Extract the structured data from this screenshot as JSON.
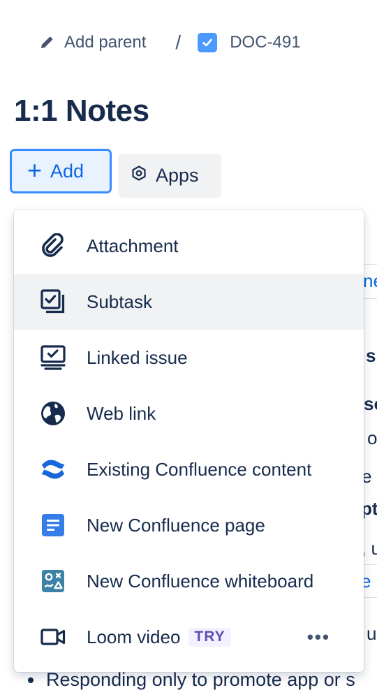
{
  "breadcrumb": {
    "parent_label": "Add parent",
    "separator": "/",
    "issue_key": "DOC-491"
  },
  "title": "1:1 Notes",
  "actions": {
    "add_label": "Add",
    "apps_label": "Apps"
  },
  "background_text": {
    "frag_1": "ne",
    "frag_2": "s",
    "frag_3": "so",
    "frag_4": "o",
    "frag_5": "e",
    "frag_6": "pt",
    "frag_7": ", u",
    "frag_8": "e",
    "frag_9": "ui",
    "bullet": "Responding only to promote app or s"
  },
  "menu": {
    "items": [
      {
        "label": "Attachment",
        "icon": "paperclip-icon"
      },
      {
        "label": "Subtask",
        "icon": "subtask-icon"
      },
      {
        "label": "Linked issue",
        "icon": "linked-issue-icon"
      },
      {
        "label": "Web link",
        "icon": "globe-icon"
      },
      {
        "label": "Existing Confluence content",
        "icon": "confluence-icon"
      },
      {
        "label": "New Confluence page",
        "icon": "confluence-page-icon"
      },
      {
        "label": "New Confluence whiteboard",
        "icon": "confluence-whiteboard-icon"
      },
      {
        "label": "Loom video",
        "icon": "video-camera-icon",
        "badge": "TRY"
      }
    ],
    "selected_index": 1,
    "more_label": "•••"
  },
  "colors": {
    "accent": "#0c66e4",
    "add_button_bg": "#e9f2ff",
    "add_button_border": "#388bff",
    "selected_row_bg": "#f1f2f4",
    "try_badge_bg": "#f3f0ff",
    "try_badge_text": "#5e4db2",
    "confluence_blue": "#1868db",
    "whiteboard_teal": "#3b82a6"
  }
}
